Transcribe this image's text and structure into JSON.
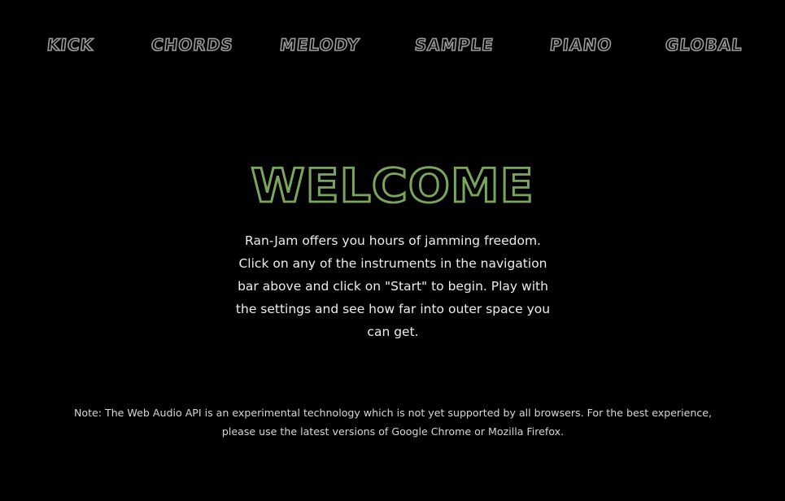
{
  "nav": {
    "items": [
      {
        "label": "KICK"
      },
      {
        "label": "CHORDS"
      },
      {
        "label": "MELODY"
      },
      {
        "label": "SAMPLE"
      },
      {
        "label": "PIANO"
      },
      {
        "label": "GLOBAL"
      }
    ]
  },
  "main": {
    "title": "WELCOME",
    "intro": "Ran-Jam offers you hours of jamming freedom. Click on any of the instruments in the navigation bar above and click on \"Start\" to begin. Play with the settings and see how far into outer space you can get.",
    "note": "Note: The Web Audio API is an experimental technology which is not yet supported by all browsers. For the best experience, please use the latest versions of Google Chrome or Mozilla Firefox."
  },
  "colors": {
    "background": "#000000",
    "nav_outline": "#9a9a9a",
    "title_accent": "#7aa55a",
    "body_text": "#ececec"
  }
}
